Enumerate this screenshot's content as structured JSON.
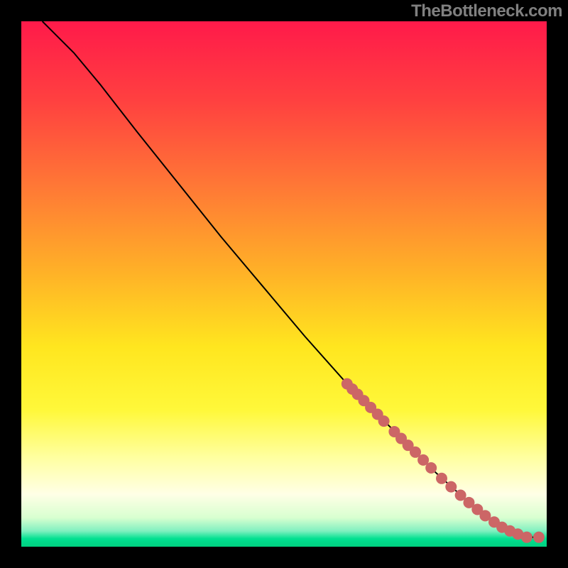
{
  "watermark": "TheBottleneck.com",
  "colors": {
    "curve": "#000000",
    "markers": "#cc6666",
    "frame": "#000000"
  },
  "gradient_stops": [
    {
      "offset": 0.0,
      "color": "#ff1a4a"
    },
    {
      "offset": 0.15,
      "color": "#ff4040"
    },
    {
      "offset": 0.32,
      "color": "#ff7a35"
    },
    {
      "offset": 0.48,
      "color": "#ffb227"
    },
    {
      "offset": 0.62,
      "color": "#ffe61f"
    },
    {
      "offset": 0.74,
      "color": "#fff83a"
    },
    {
      "offset": 0.83,
      "color": "#ffffa0"
    },
    {
      "offset": 0.9,
      "color": "#ffffe6"
    },
    {
      "offset": 0.945,
      "color": "#d8ffd0"
    },
    {
      "offset": 0.97,
      "color": "#80f0c0"
    },
    {
      "offset": 0.985,
      "color": "#00e090"
    },
    {
      "offset": 1.0,
      "color": "#00d080"
    }
  ],
  "chart_data": {
    "type": "line",
    "title": "",
    "xlabel": "",
    "ylabel": "",
    "xlim": [
      0,
      100
    ],
    "ylim": [
      0,
      100
    ],
    "series": [
      {
        "name": "curve",
        "x": [
          4,
          6,
          10,
          15,
          22,
          30,
          38,
          46,
          54,
          62,
          68,
          74,
          79,
          84,
          88,
          91,
          93.5,
          95,
          96.5,
          98.5
        ],
        "y": [
          100,
          98,
          94,
          88,
          79,
          69,
          59,
          49.5,
          40,
          31,
          25,
          19,
          14,
          9.5,
          6,
          4,
          2.8,
          2.2,
          1.8,
          1.8
        ]
      }
    ],
    "markers": [
      {
        "x": 62.0,
        "y": 31.0
      },
      {
        "x": 63.0,
        "y": 30.0
      },
      {
        "x": 64.0,
        "y": 29.0
      },
      {
        "x": 65.2,
        "y": 27.8
      },
      {
        "x": 66.5,
        "y": 26.5
      },
      {
        "x": 67.8,
        "y": 25.2
      },
      {
        "x": 69.0,
        "y": 23.9
      },
      {
        "x": 71.0,
        "y": 21.9
      },
      {
        "x": 72.3,
        "y": 20.6
      },
      {
        "x": 73.6,
        "y": 19.3
      },
      {
        "x": 75.0,
        "y": 18.0
      },
      {
        "x": 76.5,
        "y": 16.5
      },
      {
        "x": 78.0,
        "y": 15.0
      },
      {
        "x": 80.0,
        "y": 13.0
      },
      {
        "x": 81.8,
        "y": 11.4
      },
      {
        "x": 83.6,
        "y": 9.8
      },
      {
        "x": 85.2,
        "y": 8.4
      },
      {
        "x": 86.8,
        "y": 7.1
      },
      {
        "x": 88.3,
        "y": 5.9
      },
      {
        "x": 90.0,
        "y": 4.7
      },
      {
        "x": 91.5,
        "y": 3.7
      },
      {
        "x": 93.0,
        "y": 3.0
      },
      {
        "x": 94.5,
        "y": 2.4
      },
      {
        "x": 96.2,
        "y": 1.8
      },
      {
        "x": 98.5,
        "y": 1.8
      }
    ]
  }
}
